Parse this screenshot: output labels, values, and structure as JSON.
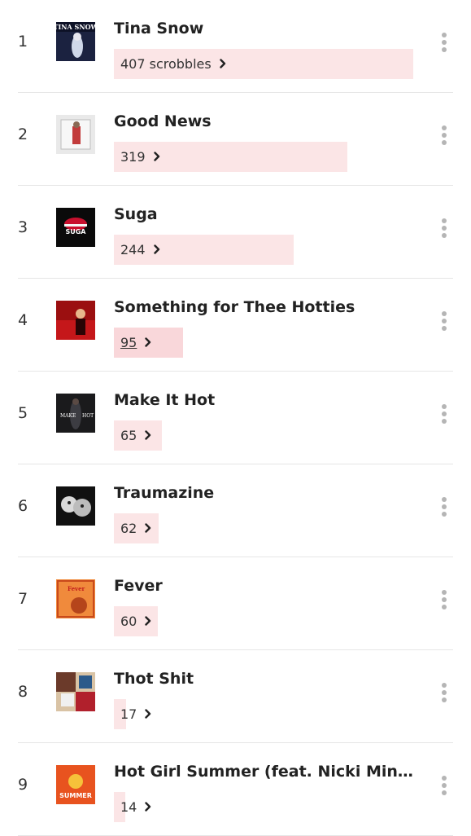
{
  "tracks": [
    {
      "rank": "1",
      "title": "Tina Snow",
      "count": "407 scrobbles",
      "fraction": 1.0,
      "hover": false,
      "underline": false
    },
    {
      "rank": "2",
      "title": "Good News",
      "count": "319",
      "fraction": 0.78,
      "hover": false,
      "underline": false
    },
    {
      "rank": "3",
      "title": "Suga",
      "count": "244",
      "fraction": 0.6,
      "hover": false,
      "underline": false
    },
    {
      "rank": "4",
      "title": "Something for Thee Hotties",
      "count": "95",
      "fraction": 0.23,
      "hover": true,
      "underline": true
    },
    {
      "rank": "5",
      "title": "Make It Hot",
      "count": "65",
      "fraction": 0.16,
      "hover": false,
      "underline": false
    },
    {
      "rank": "6",
      "title": "Traumazine",
      "count": "62",
      "fraction": 0.15,
      "hover": false,
      "underline": false
    },
    {
      "rank": "7",
      "title": "Fever",
      "count": "60",
      "fraction": 0.147,
      "hover": false,
      "underline": false
    },
    {
      "rank": "8",
      "title": "Thot Shit",
      "count": "17",
      "fraction": 0.042,
      "hover": false,
      "underline": false
    },
    {
      "rank": "9",
      "title": "Hot Girl Summer (feat. Nicki Minaj & T...",
      "count": "14",
      "fraction": 0.034,
      "hover": false,
      "underline": false
    }
  ],
  "colors": {
    "bar": "#fbe5e6",
    "bar_hover": "#f9d7da",
    "menu_dots": "#b5b5b5"
  },
  "icons": {
    "chevron": "chevron-right-icon",
    "menu": "more-vertical-icon"
  }
}
